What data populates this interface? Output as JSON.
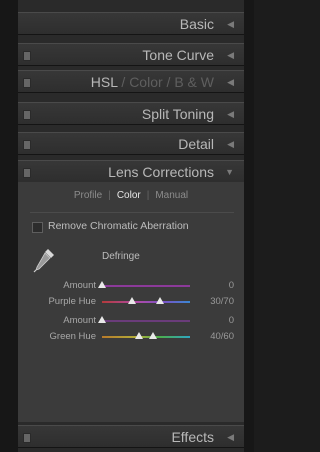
{
  "panels": {
    "basic": {
      "title": "Basic"
    },
    "tone_curve": {
      "title": "Tone Curve"
    },
    "hsl": {
      "hsl": "HSL",
      "sep1": " / ",
      "color": "Color",
      "sep2": " / ",
      "bw": "B & W"
    },
    "split_toning": {
      "title": "Split Toning"
    },
    "detail": {
      "title": "Detail"
    },
    "lens_corrections": {
      "title": "Lens Corrections"
    },
    "effects": {
      "title": "Effects"
    }
  },
  "lens": {
    "tabs": [
      "Profile",
      "Color",
      "Manual"
    ],
    "active_tab": "Color",
    "remove_ca_label": "Remove Chromatic Aberration",
    "remove_ca_checked": false,
    "defringe_label": "Defringe",
    "sliders": [
      {
        "label": "Amount",
        "value": "0",
        "knobs": [
          0.0
        ]
      },
      {
        "label": "Purple Hue",
        "value": "30/70",
        "knobs": [
          0.34,
          0.66
        ]
      },
      {
        "label": "Amount",
        "value": "0",
        "knobs": [
          0.0
        ]
      },
      {
        "label": "Green Hue",
        "value": "40/60",
        "knobs": [
          0.42,
          0.58
        ]
      }
    ]
  },
  "icons": {
    "collapsed_indicator": "triangle-left-icon",
    "expanded_indicator": "triangle-down-icon",
    "eyedropper": "eyedropper-icon",
    "panel_switch": "panel-switch-icon"
  },
  "colors": {
    "panel_header": "#333333",
    "content_bg": "#3b3b3b",
    "active_text": "#e6e6e6",
    "inactive_text": "#8c8c8c"
  }
}
